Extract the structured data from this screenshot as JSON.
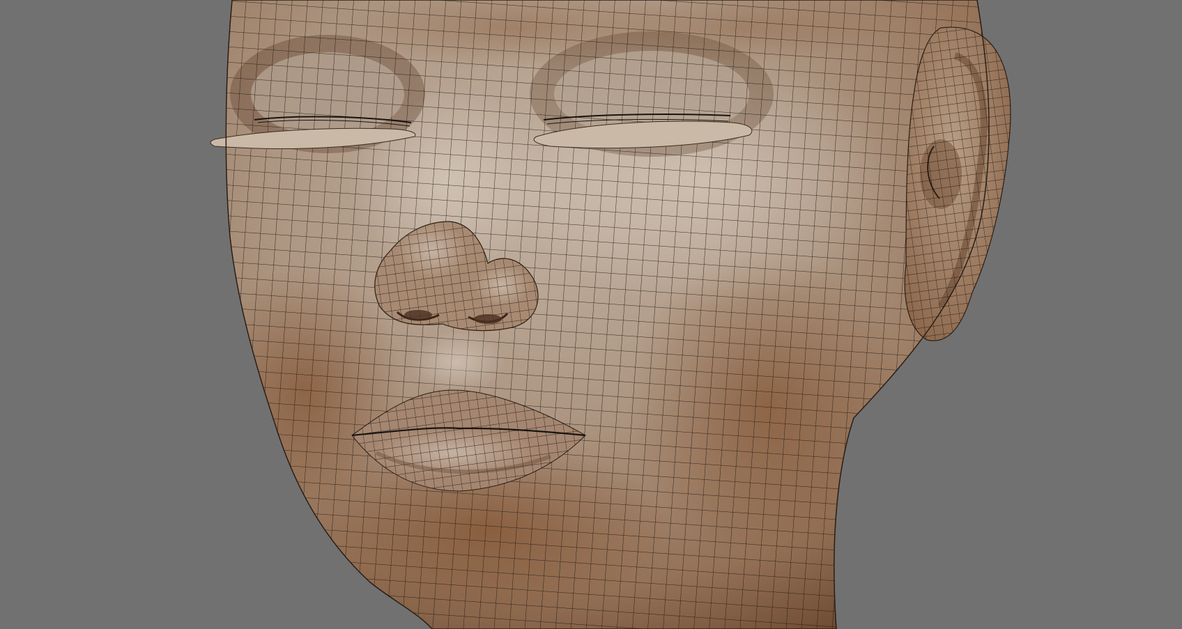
{
  "viewport": {
    "background_color": "#717171",
    "object": "head-mesh",
    "display_mode": "smooth-shaded-with-wireframe",
    "skin_color": "#b29d88",
    "shadow_color": "#7a4a2a",
    "wire_color": "#1a1410"
  }
}
